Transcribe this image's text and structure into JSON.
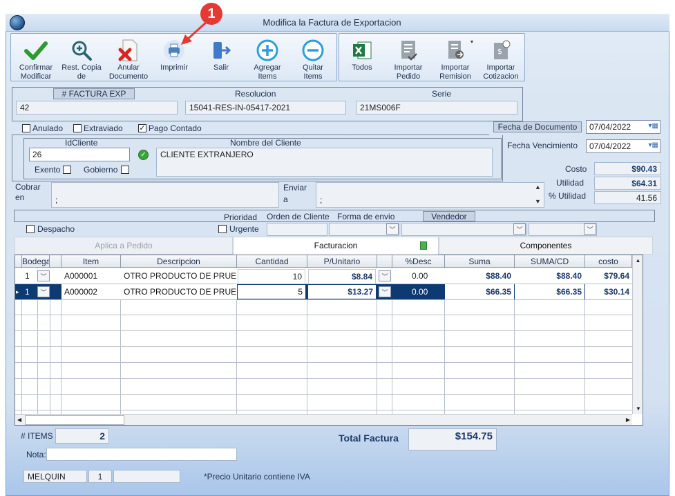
{
  "window": {
    "title": "Modifica la Factura de Exportacion"
  },
  "callout": {
    "number": "1"
  },
  "toolbar": {
    "confirmar": "Confirmar Modificar",
    "rest_copia": "Rest. Copia de",
    "anular": "Anular Documento",
    "imprimir": "Imprimir",
    "salir": "Salir",
    "agregar": "Agregar Items",
    "quitar": "Quitar Items",
    "todos": "Todos",
    "importar_pedido": "Importar Pedido",
    "importar_remision": "Importar Remision",
    "importar_cotizacion": "Importar Cotizacion"
  },
  "header": {
    "factura_label": "# FACTURA EXP",
    "factura_value": "42",
    "resolucion_label": "Resolucion",
    "resolucion_value": "15041-RES-IN-05417-2021",
    "serie_label": "Serie",
    "serie_value": "21MS006F"
  },
  "flags": {
    "anulado": "Anulado",
    "extraviado": "Extraviado",
    "pago_contado": "Pago Contado"
  },
  "fecha_documento": {
    "label": "Fecha de Documento",
    "value": "07/04/2022"
  },
  "fecha_vencimiento": {
    "label": "Fecha Vencimiento",
    "value": "07/04/2022"
  },
  "cliente": {
    "id_label": "IdCliente",
    "id_value": "26",
    "nombre_label": "Nombre del Cliente",
    "nombre_value": "CLIENTE EXTRANJERO",
    "exento": "Exento",
    "gobierno": "Gobierno"
  },
  "totales_side": {
    "costo_label": "Costo",
    "costo_value": "$90.43",
    "utilidad_label": "Utilidad",
    "utilidad_value": "$64.31",
    "putilidad_label": "% Utilidad",
    "putilidad_value": "41.56"
  },
  "cobrar": {
    "label1": "Cobrar",
    "label2": "en",
    "value": ";"
  },
  "enviar": {
    "label1": "Enviar",
    "label2": "a",
    "value": ";"
  },
  "opciones": {
    "prioridad": "Prioridad",
    "orden_cliente": "Orden de Cliente",
    "forma_envio": "Forma de envio",
    "vendedor": "Vendedor",
    "despacho": "Despacho",
    "urgente": "Urgente"
  },
  "tabs": {
    "aplica": "Aplica a Pedido",
    "facturacion": "Facturacion",
    "componentes": "Componentes"
  },
  "grid": {
    "columns": [
      "Bodega",
      "Item",
      "Descripcion",
      "Cantidad",
      "P/Unitario",
      "%Desc",
      "Suma",
      "SUMA/CD",
      "costo"
    ],
    "rows": [
      {
        "bodega": "1",
        "item": "A000001",
        "descripcion": "OTRO PRODUCTO DE PRUE",
        "cantidad": "10",
        "punitario": "$8.84",
        "desc": "0.00",
        "suma": "$88.40",
        "sumacd": "$88.40",
        "costo": "$79.64"
      },
      {
        "bodega": "1",
        "item": "A000002",
        "descripcion": "OTRO PRODUCTO DE PRUE",
        "cantidad": "5",
        "punitario": "$13.27",
        "desc": "0.00",
        "suma": "$66.35",
        "sumacd": "$66.35",
        "costo": "$30.14"
      }
    ]
  },
  "footer": {
    "items_label": "# ITEMS",
    "items_value": "2",
    "total_label": "Total Factura",
    "total_value": "$154.75",
    "nota_label": "Nota:",
    "user": "MELQUIN",
    "user_num": "1",
    "note": "*Precio Unitario contiene IVA"
  }
}
